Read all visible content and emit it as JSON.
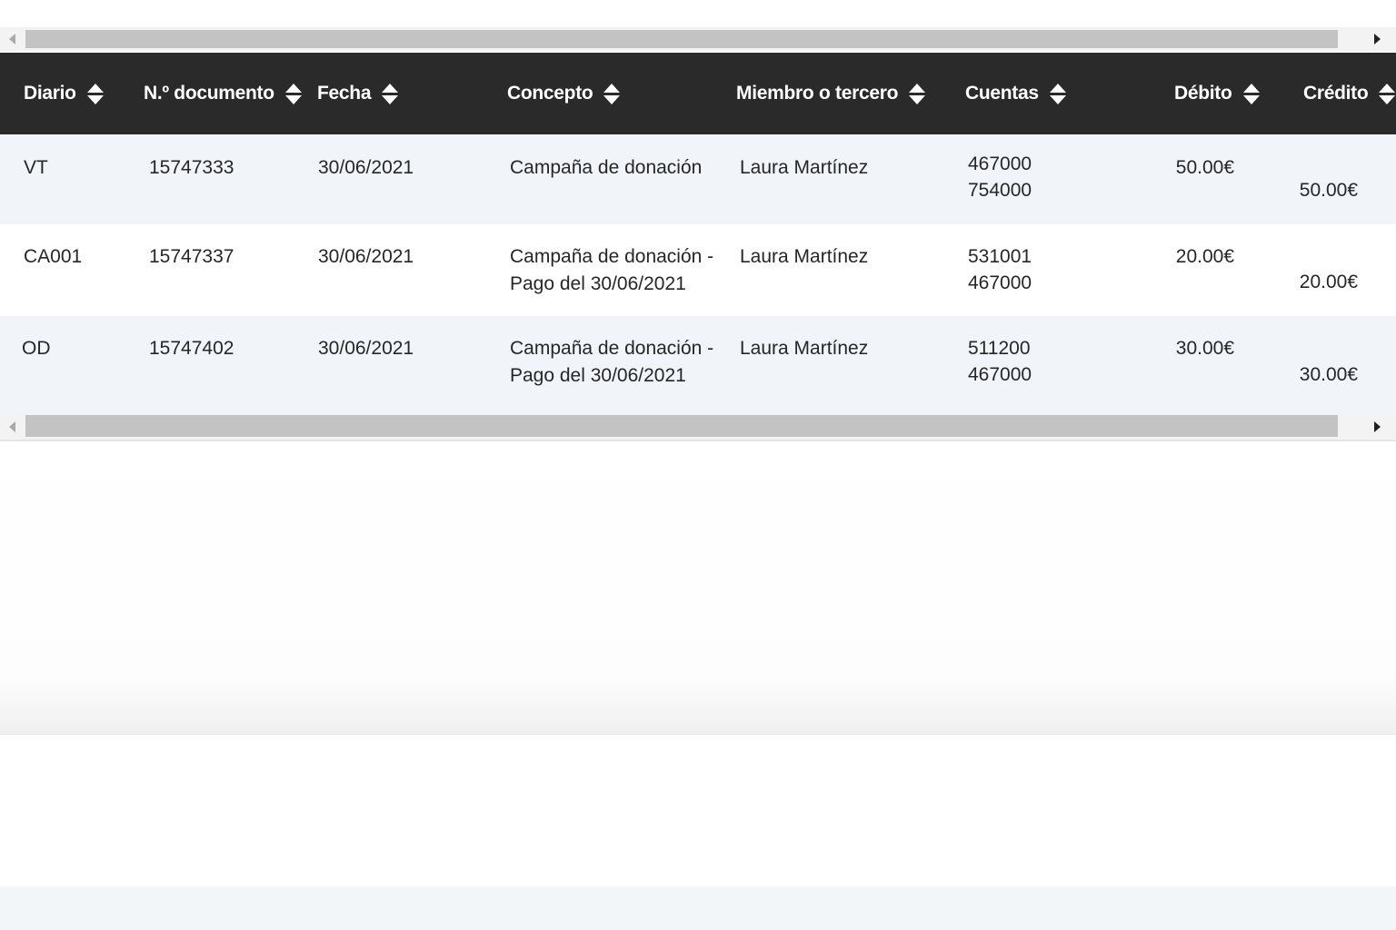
{
  "table": {
    "columns": [
      {
        "label": "Diario"
      },
      {
        "label": "N.º documento"
      },
      {
        "label": "Fecha"
      },
      {
        "label": "Concepto"
      },
      {
        "label": "Miembro o tercero"
      },
      {
        "label": "Cuentas"
      },
      {
        "label": "Débito"
      },
      {
        "label": "Crédito"
      }
    ],
    "rows": [
      {
        "diario": "VT",
        "documento": "15747333",
        "fecha": "30/06/2021",
        "concepto_1": "Campaña de donación",
        "concepto_2": "",
        "miembro": "Laura Martínez",
        "cuenta_1": "467000",
        "cuenta_2": "754000",
        "debito": "50.00€",
        "credito": "50.00€"
      },
      {
        "diario": "CA001",
        "documento": "15747337",
        "fecha": "30/06/2021",
        "concepto_1": "Campaña de donación -",
        "concepto_2": "Pago del 30/06/2021",
        "miembro": "Laura Martínez",
        "cuenta_1": "531001",
        "cuenta_2": "467000",
        "debito": "20.00€",
        "credito": "20.00€"
      },
      {
        "diario": "OD",
        "documento": "15747402",
        "fecha": "30/06/2021",
        "concepto_1": "Campaña de donación -",
        "concepto_2": "Pago del 30/06/2021",
        "miembro": "Laura Martínez",
        "cuenta_1": "511200",
        "cuenta_2": "467000",
        "debito": "30.00€",
        "credito": "30.00€"
      }
    ]
  },
  "icons": {
    "sort": "sort-up-down-icon",
    "scroll_left": "scroll-left-arrow-icon",
    "scroll_right": "scroll-right-arrow-icon"
  },
  "colors": {
    "header_bg": "#2a2a2a",
    "header_text": "#ffffff",
    "row_alt_bg": "#f1f5f9",
    "scrollbar_thumb": "#c3c3c3"
  }
}
